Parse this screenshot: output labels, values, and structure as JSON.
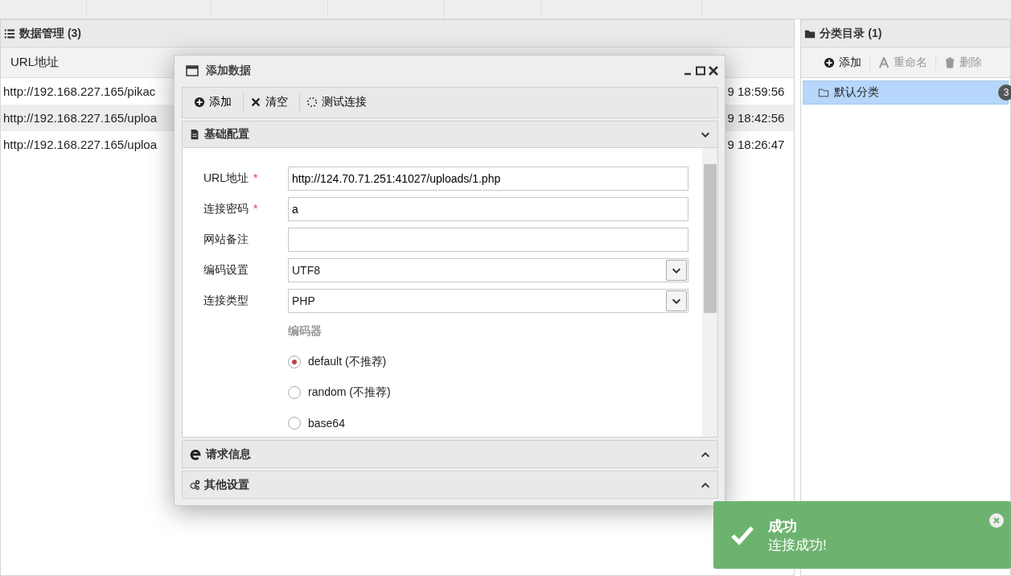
{
  "data_panel": {
    "title": "数据管理 (3)",
    "columns": [
      "URL地址"
    ],
    "rows": [
      {
        "url": "http://192.168.227.165/pikac",
        "column_2": "9 18:59:56",
        "selected": false
      },
      {
        "url": "http://192.168.227.165/uploa",
        "column_2": "9 18:42:56",
        "selected": true
      },
      {
        "url": "http://192.168.227.165/uploa",
        "column_2": "9 18:26:47",
        "selected": false
      }
    ]
  },
  "category_panel": {
    "title": "分类目录 (1)",
    "toolbar": [
      {
        "label": "添加",
        "disabled": false
      },
      {
        "label": "重命名",
        "disabled": true
      },
      {
        "label": "删除",
        "disabled": true
      }
    ],
    "items": [
      {
        "label": "默认分类",
        "count": "3",
        "selected": true
      }
    ]
  },
  "dialog": {
    "title": "添加数据",
    "toolbar": [
      "添加",
      "清空",
      "测试连接"
    ],
    "sections": [
      {
        "title": "基础配置",
        "expanded": true
      },
      {
        "title": "请求信息",
        "expanded": false
      },
      {
        "title": "其他设置",
        "expanded": false
      }
    ],
    "fields": [
      {
        "kind": "text",
        "label": "URL地址",
        "required_mark": "*",
        "value": "http://124.70.71.251:41027/uploads/1.php"
      },
      {
        "kind": "text",
        "label": "连接密码",
        "required_mark": "*",
        "value": "a"
      },
      {
        "kind": "text",
        "label": "网站备注"
      },
      {
        "kind": "select",
        "label": "编码设置",
        "value": "UTF8"
      },
      {
        "kind": "select",
        "label": "连接类型",
        "value": "PHP"
      }
    ],
    "encoder": {
      "label": "编码器",
      "options": [
        {
          "label": "default (不推荐)",
          "selected": true
        },
        {
          "label": "random (不推荐)",
          "selected": false
        },
        {
          "label": "base64",
          "selected": false
        }
      ]
    }
  },
  "toast": {
    "title": "成功",
    "message": "连接成功!"
  }
}
